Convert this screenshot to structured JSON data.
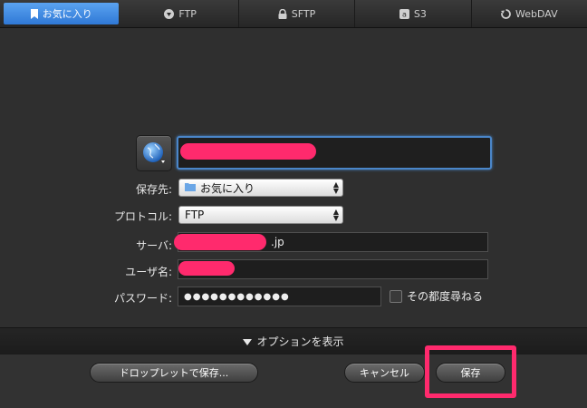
{
  "tabs": [
    {
      "label": "お気に入り",
      "icon": "bookmark-icon",
      "active": true
    },
    {
      "label": "FTP",
      "icon": "ftp-icon",
      "active": false
    },
    {
      "label": "SFTP",
      "icon": "lock-icon",
      "active": false
    },
    {
      "label": "S3",
      "icon": "s3-icon",
      "active": false
    },
    {
      "label": "WebDAV",
      "icon": "webdav-icon",
      "active": false
    }
  ],
  "form": {
    "name_value": "",
    "destination_label": "保存先:",
    "destination_value": "お気に入り",
    "protocol_label": "プロトコル:",
    "protocol_value": "FTP",
    "server_label": "サーバ:",
    "server_value_suffix": ".jp",
    "user_label": "ユーザ名:",
    "user_value": "",
    "password_label": "パスワード:",
    "password_value": "●●●●●●●●●●●●",
    "ask_each_time_label": "その都度尋ねる"
  },
  "options_toggle_label": "オプションを表示",
  "buttons": {
    "droplet": "ドロップレットで保存...",
    "cancel": "キャンセル",
    "save": "保存"
  },
  "colors": {
    "accent": "#3b8ae6",
    "redaction": "#ff2a6d",
    "highlight": "#ff2a6d"
  }
}
